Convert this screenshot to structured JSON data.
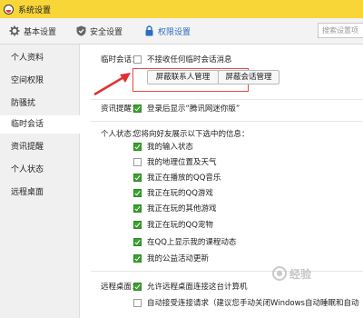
{
  "window": {
    "title": "系统设置"
  },
  "toolbar": {
    "tabs": [
      {
        "label": "基本设置",
        "icon": "gear-icon"
      },
      {
        "label": "安全设置",
        "icon": "shield-icon"
      },
      {
        "label": "权限设置",
        "icon": "lock-icon",
        "active": true
      }
    ],
    "search": {
      "placeholder": "搜索设置项"
    }
  },
  "sidebar": {
    "items": [
      {
        "label": "个人资料"
      },
      {
        "label": "空间权限"
      },
      {
        "label": "防骚扰"
      },
      {
        "label": "临时会话",
        "active": true
      },
      {
        "label": "资讯提醒"
      },
      {
        "label": "个人状态"
      },
      {
        "label": "远程桌面"
      }
    ]
  },
  "temp_session": {
    "section_label": "临时会话：",
    "no_receive": {
      "label": "不接收任何临时会话消息",
      "checked": false
    },
    "btn_shield_contacts": "屏蔽联系人管理",
    "btn_shield_sessions": "屏蔽会话管理"
  },
  "news": {
    "section_label": "资讯提醒：",
    "mini_news": {
      "label": "登录后显示“腾讯网迷你版”",
      "checked": true
    }
  },
  "status": {
    "section_label": "个人状态：",
    "desc": "您将向好友展示以下选中的信息：",
    "options": [
      {
        "label": "我的输入状态",
        "checked": true
      },
      {
        "label": "我的地理位置及天气",
        "checked": false
      },
      {
        "label": "我正在播放的QQ音乐",
        "checked": true
      },
      {
        "label": "我正在玩的QQ游戏",
        "checked": true
      },
      {
        "label": "我正在玩的其他游戏",
        "checked": true
      },
      {
        "label": "我正在玩的QQ宠物",
        "checked": true
      },
      {
        "label": "在QQ上显示我的课程动态",
        "checked": true
      },
      {
        "label": "我的公益活动更新",
        "checked": true
      }
    ]
  },
  "remote": {
    "section_label": "远程桌面：",
    "options": [
      {
        "label": "允许远程桌面连接这台计算机",
        "checked": true
      },
      {
        "label": "自动接受连接请求（建议您手动关闭Windows自动睡眠和自动",
        "checked": false
      }
    ]
  },
  "watermark": {
    "text": "经验"
  }
}
